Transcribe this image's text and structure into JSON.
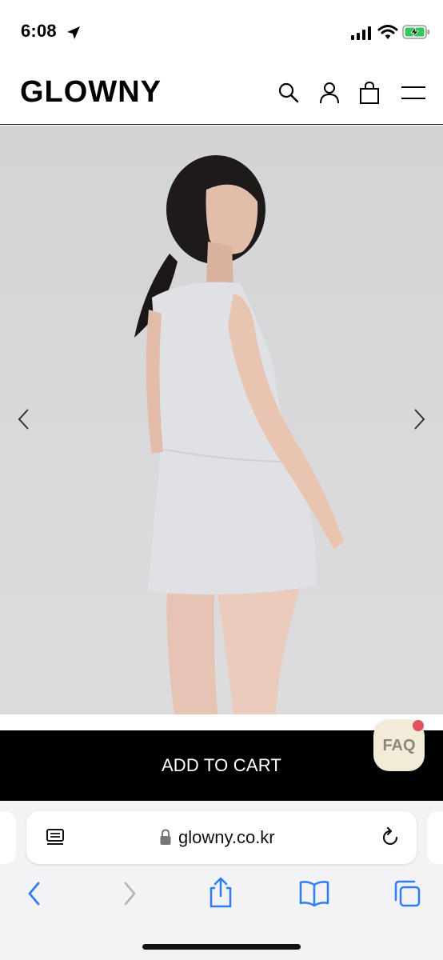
{
  "status_bar": {
    "time": "6:08"
  },
  "header": {
    "logo": "GLOWNY"
  },
  "product": {
    "add_to_cart_label": "ADD TO CART"
  },
  "faq": {
    "label": "FAQ"
  },
  "browser": {
    "url": "glowny.co.kr"
  },
  "colors": {
    "accent": "#000000",
    "faq_bg": "#f1ebd8",
    "faq_dot": "#e0525e",
    "link_blue": "#2d7df6"
  }
}
